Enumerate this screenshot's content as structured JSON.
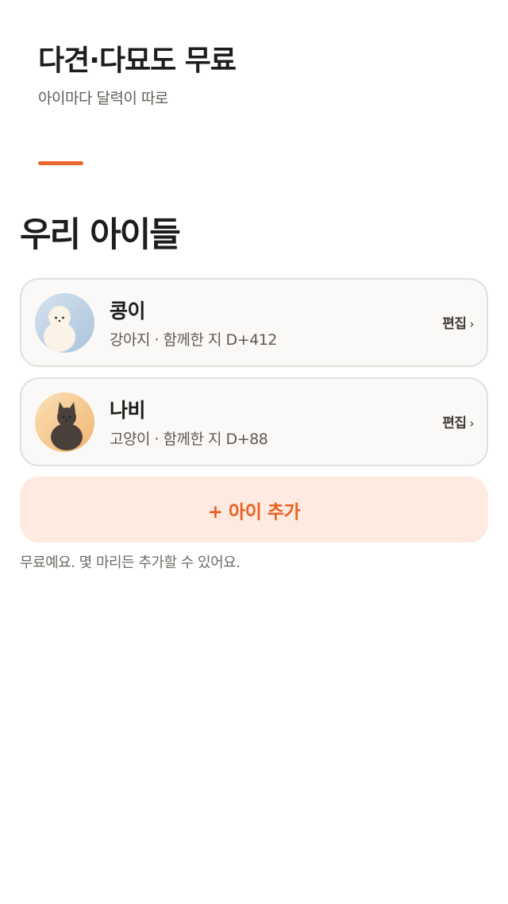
{
  "hero": {
    "title": "다견·다묘도 무료",
    "subtitle": "아이마다 달력이 따로"
  },
  "section": {
    "title": "우리 아이들"
  },
  "pets": [
    {
      "name": "콩이",
      "meta": "강아지 · 함께한 지 D+412",
      "edit_label": "편집",
      "chevron": "›",
      "avatar_icon": "dog-avatar-icon"
    },
    {
      "name": "나비",
      "meta": "고양이 · 함께한 지 D+88",
      "edit_label": "편집",
      "chevron": "›",
      "avatar_icon": "cat-avatar-icon"
    }
  ],
  "add_button": {
    "label": "+ 아이 추가"
  },
  "footnote": "무료예요. 몇 마리든 추가할 수 있어요.",
  "colors": {
    "accent": "#e8672a",
    "add_button_bg": "#feeae1",
    "card_bg": "#faf9f7",
    "card_border": "#e2e0dd"
  }
}
